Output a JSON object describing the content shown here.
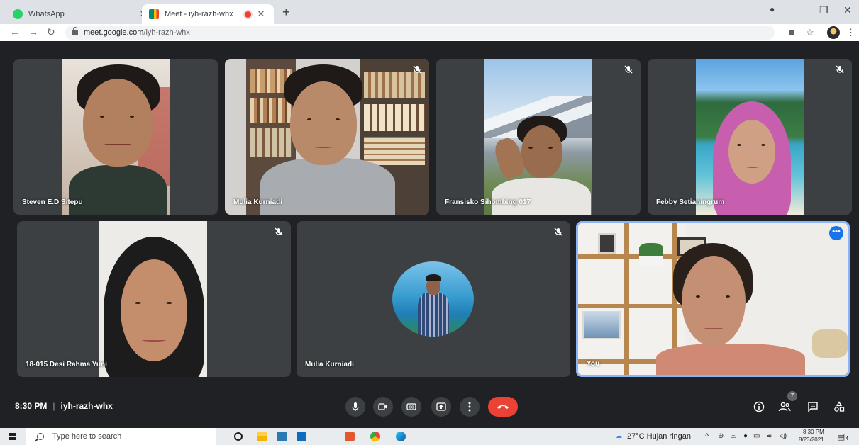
{
  "browser": {
    "tabs": [
      {
        "title": "WhatsApp",
        "favicon": "whatsapp-icon",
        "color": "#25d366",
        "active": false
      },
      {
        "title": "Meet - iyh-razh-whx",
        "favicon": "meet-icon",
        "color": "#00897b",
        "active": true,
        "recording": true
      }
    ],
    "url_host": "meet.google.com",
    "url_path": "/iyh-razh-whx"
  },
  "meet": {
    "accent": "#8ab4f8",
    "participants": [
      {
        "name": "Steven E.D Sitepu",
        "muted": false
      },
      {
        "name": "Mulia Kurniadi",
        "muted": true
      },
      {
        "name": "Fransisko Sihombing 017",
        "muted": true
      },
      {
        "name": "Febby Setianingrum",
        "muted": true
      },
      {
        "name": "18-015 Desi Rahma Yuni",
        "muted": true
      },
      {
        "name": "Mulia Kurniadi",
        "muted": true,
        "avatar_only": true
      },
      {
        "name": "You",
        "muted": false,
        "self": true
      }
    ],
    "time": "8:30 PM",
    "meeting_code": "iyh-razh-whx",
    "controls": [
      "microphone-icon",
      "camera-icon",
      "captions-icon",
      "present-icon",
      "more-options-icon",
      "end-call-icon"
    ],
    "right_controls": [
      "info-icon",
      "people-icon",
      "chat-icon",
      "activities-icon"
    ],
    "people_count": "7",
    "end_call_color": "#ea4335"
  },
  "taskbar": {
    "search_placeholder": "Type here to search",
    "weather": "27°C Hujan ringan",
    "clock_time": "8:30 PM",
    "clock_date": "8/23/2021",
    "notification_count": "4"
  }
}
